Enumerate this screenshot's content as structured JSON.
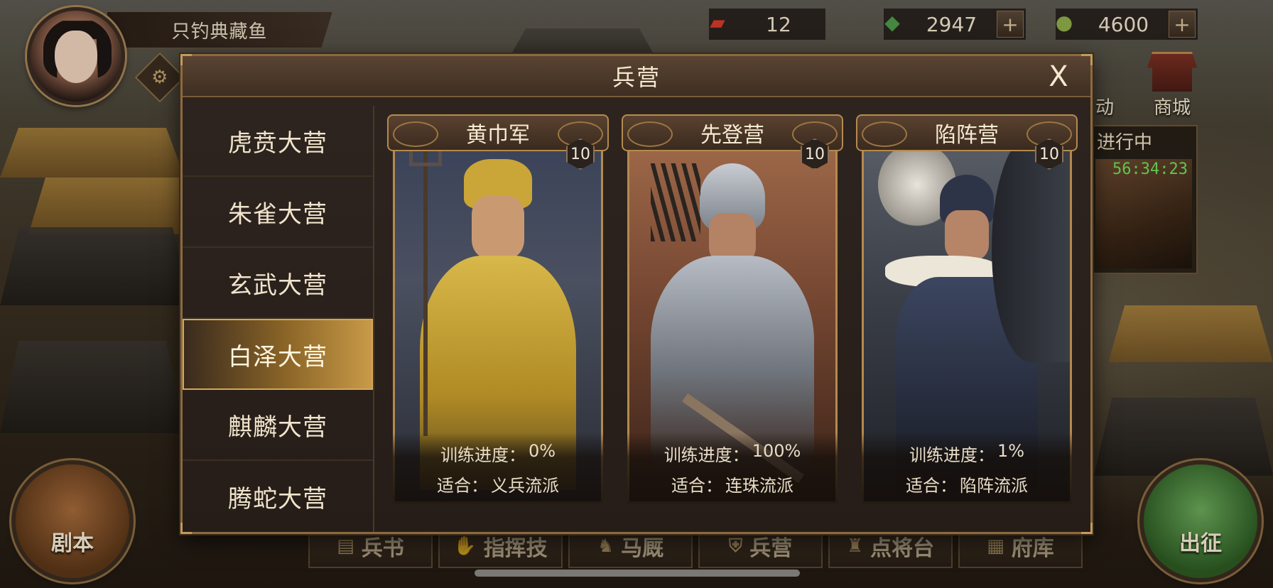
{
  "player": {
    "name": "只钓典藏鱼"
  },
  "resources": [
    {
      "icon": "red-token-icon",
      "value": "12"
    },
    {
      "icon": "jade-icon",
      "value": "2947",
      "plus": "+"
    },
    {
      "icon": "gourd-icon",
      "value": "4600",
      "plus": "+"
    }
  ],
  "map_widgets": {
    "event_label": "动",
    "shop_label": "商城",
    "in_progress_label": "进行中",
    "timer": "56:34:23"
  },
  "round_buttons": {
    "script_label": "剧本",
    "march_label": "出征"
  },
  "bottom_menu": [
    {
      "icon": "book-icon",
      "label": "兵书"
    },
    {
      "icon": "command-icon",
      "label": "指挥技"
    },
    {
      "icon": "horse-icon",
      "label": "马厩"
    },
    {
      "icon": "shield-icon",
      "label": "兵营"
    },
    {
      "icon": "general-icon",
      "label": "点将台"
    },
    {
      "icon": "storehouse-icon",
      "label": "府库"
    }
  ],
  "dialog": {
    "title": "兵营",
    "close_label": "X",
    "camps": [
      {
        "label": "虎贲大营",
        "active": false
      },
      {
        "label": "朱雀大营",
        "active": false
      },
      {
        "label": "玄武大营",
        "active": false
      },
      {
        "label": "白泽大营",
        "active": true
      },
      {
        "label": "麒麟大营",
        "active": false
      },
      {
        "label": "腾蛇大营",
        "active": false
      }
    ],
    "cards": [
      {
        "name": "黄巾军",
        "level": "10",
        "progress_label": "训练进度：",
        "progress_value": "0%",
        "suit_label": "适合：",
        "suit_value": "义兵流派",
        "theme": "#c4a43a"
      },
      {
        "name": "先登营",
        "level": "10",
        "progress_label": "训练进度：",
        "progress_value": "100%",
        "suit_label": "适合：",
        "suit_value": "连珠流派",
        "theme": "#8a8e96"
      },
      {
        "name": "陷阵营",
        "level": "10",
        "progress_label": "训练进度：",
        "progress_value": "1%",
        "suit_label": "适合：",
        "suit_value": "陷阵流派",
        "theme": "#3c4660"
      }
    ]
  },
  "colors": {
    "gold_border": "#b48a4e",
    "active_tab": "#c89a48",
    "timer_green": "#6fe05a"
  }
}
